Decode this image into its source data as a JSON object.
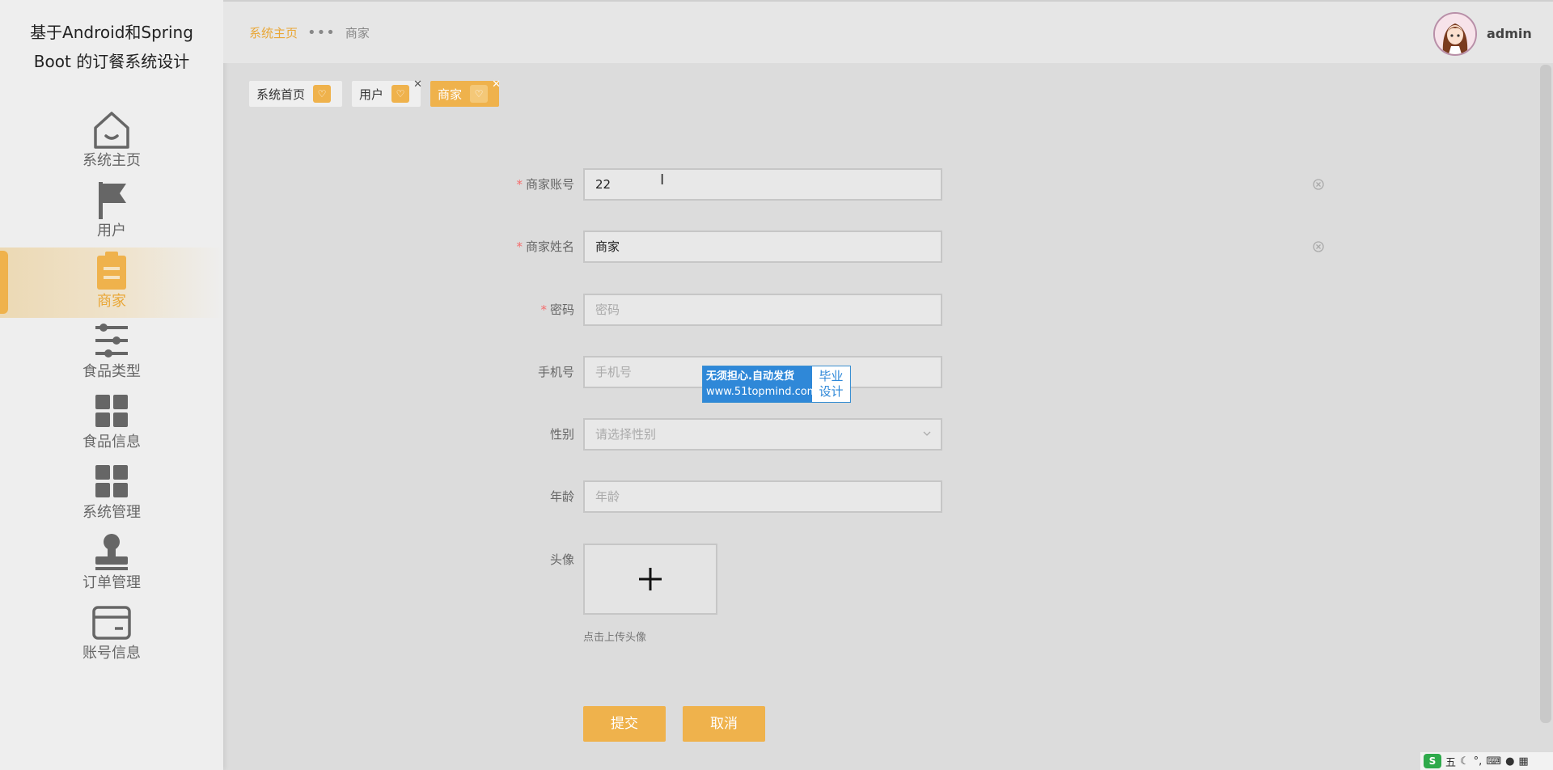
{
  "app": {
    "title": "基于Android和Spring Boot 的订餐系统设计"
  },
  "sidebar": {
    "items": [
      {
        "label": "系统主页",
        "icon": "home-icon",
        "active": false
      },
      {
        "label": "用户",
        "icon": "flag-icon",
        "active": false
      },
      {
        "label": "商家",
        "icon": "clipboard-icon",
        "active": true
      },
      {
        "label": "食品类型",
        "icon": "sliders-icon",
        "active": false
      },
      {
        "label": "食品信息",
        "icon": "grid-icon",
        "active": false
      },
      {
        "label": "系统管理",
        "icon": "grid-icon",
        "active": false
      },
      {
        "label": "订单管理",
        "icon": "stamp-icon",
        "active": false
      },
      {
        "label": "账号信息",
        "icon": "card-icon",
        "active": false
      }
    ]
  },
  "header": {
    "breadcrumb": {
      "home": "系统主页",
      "current": "商家"
    },
    "user": {
      "name": "admin",
      "avatar_icon": "avatar-icon"
    }
  },
  "tabs": [
    {
      "label": "系统首页",
      "closable": false,
      "active": false
    },
    {
      "label": "用户",
      "closable": true,
      "active": false
    },
    {
      "label": "商家",
      "closable": true,
      "active": true
    }
  ],
  "form": {
    "account": {
      "label": "商家账号",
      "value": "22",
      "required": true
    },
    "name": {
      "label": "商家姓名",
      "value": "商家",
      "required": true
    },
    "password": {
      "label": "密码",
      "placeholder": "密码",
      "required": true
    },
    "phone": {
      "label": "手机号",
      "placeholder": "手机号"
    },
    "gender": {
      "label": "性别",
      "placeholder": "请选择性别"
    },
    "age": {
      "label": "年龄",
      "placeholder": "年龄"
    },
    "avatar": {
      "label": "头像",
      "hint": "点击上传头像"
    },
    "submit_label": "提交",
    "cancel_label": "取消",
    "required_mark": "*"
  },
  "watermark": {
    "slogan": "无须担心.自动发货",
    "url": "www.51topmind.com",
    "tag_line1": "毕业",
    "tag_line2": "设计"
  },
  "tray": {
    "ime_char": "五",
    "ime_logo": "S"
  },
  "colors": {
    "accent": "#efb24c",
    "required": "#f56c6c",
    "sidebar_bg": "#eeeeee"
  }
}
